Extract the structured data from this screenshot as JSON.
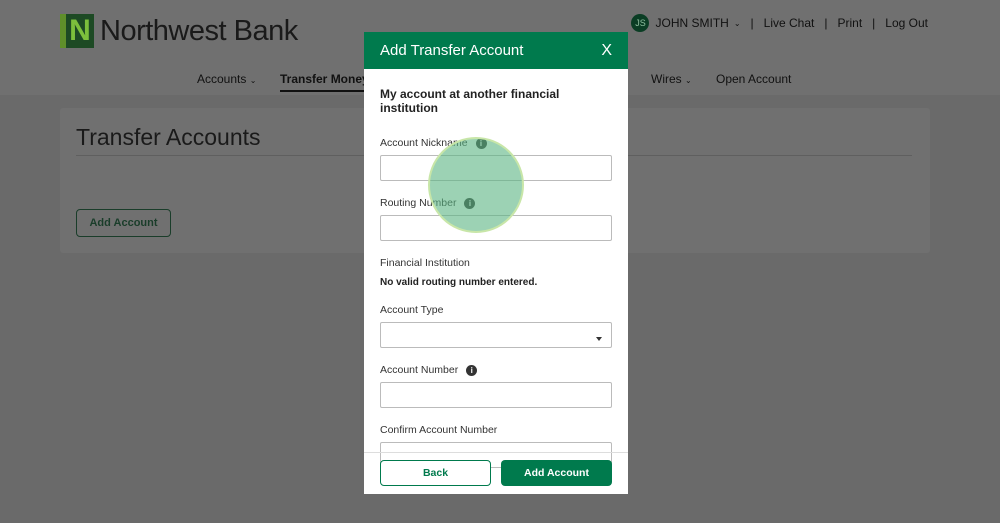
{
  "header": {
    "logo": "Northwest Bank",
    "logo_mark": "N",
    "user_initials": "JS",
    "user_name": "JOHN SMITH",
    "links": [
      "Live Chat",
      "Print",
      "Log Out"
    ]
  },
  "nav": {
    "accounts": "Accounts",
    "transfer_money": "Transfer Money",
    "wires": "Wires",
    "open_account": "Open Account"
  },
  "page": {
    "title": "Transfer Accounts",
    "add_account": "Add Account"
  },
  "modal": {
    "title": "Add Transfer Account",
    "close": "X",
    "subtitle": "My account at another financial institution",
    "fields": {
      "nickname": "Account Nickname",
      "routing": "Routing Number",
      "institution": "Financial Institution",
      "institution_value": "No valid routing number entered.",
      "type": "Account Type",
      "number": "Account Number",
      "confirm": "Confirm Account Number"
    },
    "back": "Back",
    "add": "Add Account"
  },
  "colors": {
    "brand": "#007a4d"
  }
}
